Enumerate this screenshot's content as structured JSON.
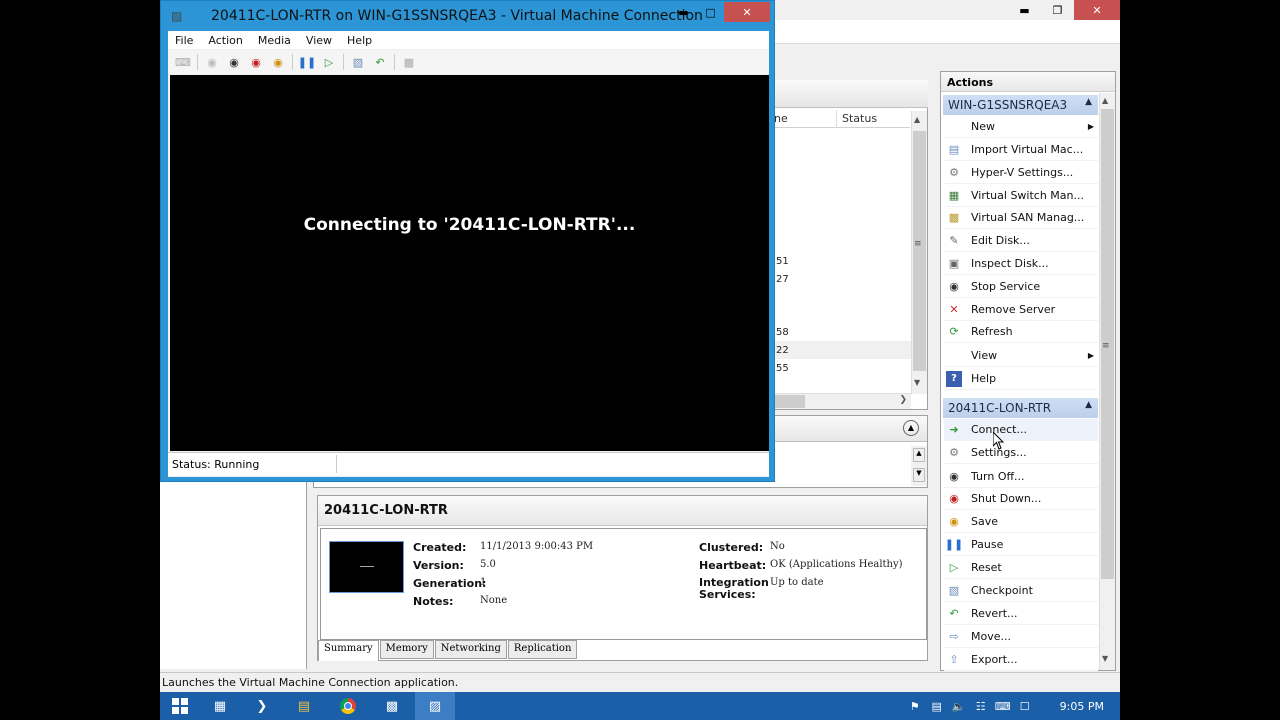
{
  "vm_window": {
    "title": "20411C-LON-RTR on WIN-G1SSNSRQEA3 - Virtual Machine Connection",
    "menu": [
      "File",
      "Action",
      "Media",
      "View",
      "Help"
    ],
    "message": "Connecting to '20411C-LON-RTR'...",
    "status": "Status: Running"
  },
  "vm_list": {
    "col_name_partial": "ne",
    "col_status": "Status",
    "partial_values": [
      "51",
      "27",
      "58",
      "22",
      "55"
    ]
  },
  "details": {
    "title": "20411C-LON-RTR",
    "left": [
      {
        "label": "Created:",
        "value": "11/1/2013 9:00:43 PM"
      },
      {
        "label": "Version:",
        "value": "5.0"
      },
      {
        "label": "Generation:",
        "value": "1"
      },
      {
        "label": "Notes:",
        "value": "None"
      }
    ],
    "right": [
      {
        "label": "Clustered:",
        "value": "No"
      },
      {
        "label": "Heartbeat:",
        "value": "OK (Applications Healthy)"
      },
      {
        "label": "Integration Services:",
        "value": "Up to date"
      }
    ],
    "tabs": [
      "Summary",
      "Memory",
      "Networking",
      "Replication"
    ]
  },
  "actions": {
    "title": "Actions",
    "server_group": "WIN-G1SSNSRQEA3",
    "server_items": [
      {
        "label": "New",
        "icon": "blank",
        "submenu": true
      },
      {
        "label": "Import Virtual Mac...",
        "icon": "import-icon"
      },
      {
        "label": "Hyper-V Settings...",
        "icon": "settings-icon"
      },
      {
        "label": "Virtual Switch Man...",
        "icon": "switch-icon"
      },
      {
        "label": "Virtual SAN Manag...",
        "icon": "san-icon"
      },
      {
        "label": "Edit Disk...",
        "icon": "edit-disk-icon"
      },
      {
        "label": "Inspect Disk...",
        "icon": "inspect-disk-icon"
      },
      {
        "label": "Stop Service",
        "icon": "stop-icon"
      },
      {
        "label": "Remove Server",
        "icon": "remove-icon"
      },
      {
        "label": "Refresh",
        "icon": "refresh-icon"
      },
      {
        "label": "View",
        "icon": "blank",
        "submenu": true
      },
      {
        "label": "Help",
        "icon": "help-icon"
      }
    ],
    "vm_group": "20411C-LON-RTR",
    "vm_items": [
      {
        "label": "Connect...",
        "icon": "connect-icon"
      },
      {
        "label": "Settings...",
        "icon": "settings-icon"
      },
      {
        "label": "Turn Off...",
        "icon": "turn-off-icon"
      },
      {
        "label": "Shut Down...",
        "icon": "shutdown-icon"
      },
      {
        "label": "Save",
        "icon": "save-icon"
      },
      {
        "label": "Pause",
        "icon": "pause-icon"
      },
      {
        "label": "Reset",
        "icon": "reset-icon"
      },
      {
        "label": "Checkpoint",
        "icon": "checkpoint-icon"
      },
      {
        "label": "Revert...",
        "icon": "revert-icon"
      },
      {
        "label": "Move...",
        "icon": "move-icon"
      },
      {
        "label": "Export...",
        "icon": "export-icon"
      }
    ]
  },
  "statusbar": "Launches the Virtual Machine Connection application.",
  "clock": "9:05 PM",
  "colors": {
    "accent": "#2b95d6",
    "taskbar": "#1a5fa8",
    "group_head": "#c4d6ef",
    "close": "#c75050"
  }
}
